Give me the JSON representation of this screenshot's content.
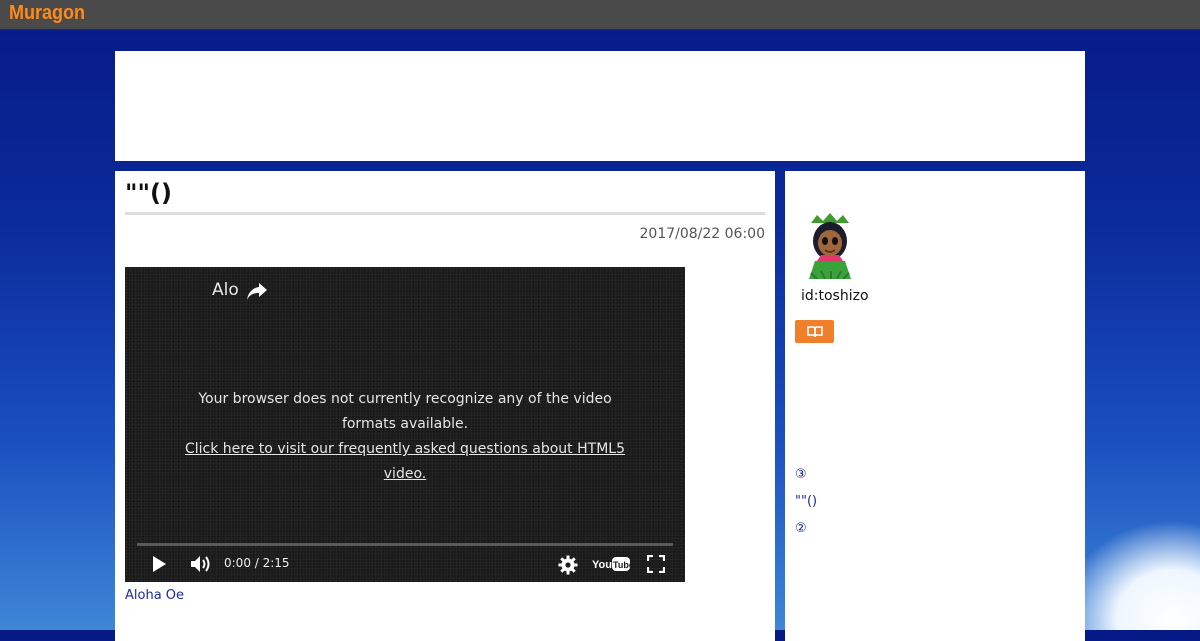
{
  "header": {
    "logo": "Muragon"
  },
  "article": {
    "title": "\"\"()",
    "date": "2017/08/22 06:00",
    "video": {
      "title": "Alo",
      "message_line1": "Your browser does not currently recognize any of the video formats available.",
      "message_link": "Click here to visit our frequently asked questions about HTML5 video.",
      "time": "0:00 / 2:15",
      "progress": 0
    },
    "video_caption": "Aloha Oe"
  },
  "sidebar": {
    "user_id": "id:toshizo",
    "links": [
      "③",
      "\"\"()",
      "②"
    ]
  },
  "colors": {
    "accent": "#ef7f2a",
    "link": "#1a2a9a",
    "logo": "#ff8a1a",
    "background_top": "#061a86"
  },
  "icons": [
    "share-icon",
    "play-icon",
    "volume-icon",
    "settings-gear-icon",
    "youtube-logo-icon",
    "fullscreen-icon",
    "book-icon"
  ]
}
